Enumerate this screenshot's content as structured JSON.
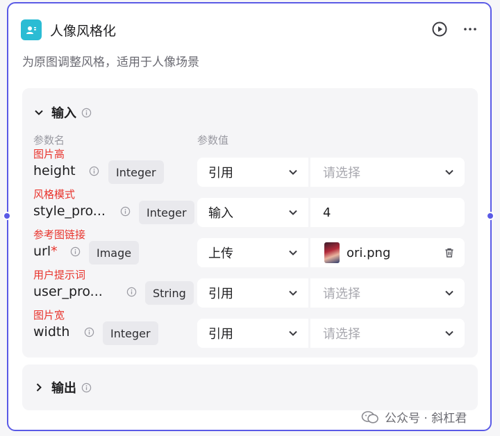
{
  "node": {
    "title": "人像风格化",
    "description": "为原图调整风格，适用于人像场景",
    "icon": "user-card-icon",
    "accent_color": "#5a5ae6",
    "icon_color": "#2bbcd4"
  },
  "header_actions": {
    "run_icon": "play-circle-icon",
    "more_icon": "more-dots-icon"
  },
  "input_section": {
    "title": "输入",
    "column_param_name": "参数名",
    "column_param_value": "参数值",
    "params": [
      {
        "cn_label": "图片高",
        "name": "height",
        "required": false,
        "type": "Integer",
        "mode": "引用",
        "value": "",
        "placeholder": "请选择"
      },
      {
        "cn_label": "风格模式",
        "name": "style_pro...",
        "required": false,
        "type": "Integer",
        "mode": "输入",
        "value": "4",
        "placeholder": ""
      },
      {
        "cn_label": "参考图链接",
        "name": "url",
        "required": true,
        "required_mark": "*",
        "type": "Image",
        "mode": "上传",
        "value": "ori.png",
        "placeholder": ""
      },
      {
        "cn_label": "用户提示词",
        "name": "user_pro...",
        "required": false,
        "type": "String",
        "mode": "引用",
        "value": "",
        "placeholder": "请选择"
      },
      {
        "cn_label": "图片宽",
        "name": "width",
        "required": false,
        "type": "Integer",
        "mode": "引用",
        "value": "",
        "placeholder": "请选择"
      }
    ]
  },
  "output_section": {
    "title": "输出"
  },
  "watermark": {
    "text": "公众号 · 斜杠君"
  },
  "colors": {
    "required_label": "#e8322b",
    "placeholder": "#a7a7ae"
  }
}
